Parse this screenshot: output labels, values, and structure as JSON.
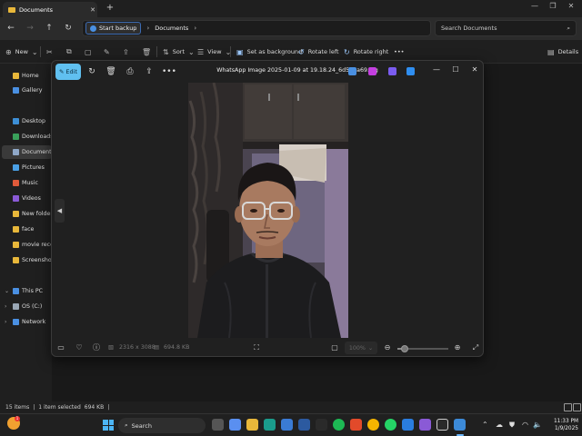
{
  "explorer": {
    "tab_title": "Documents",
    "tab_close": "✕",
    "new_tab": "+",
    "breadcrumb": [
      "Start backup",
      "Documents"
    ],
    "search_placeholder": "Search Documents",
    "commands": {
      "new": "New",
      "sort": "Sort",
      "view": "View",
      "set_background": "Set as background",
      "rotate_left": "Rotate left",
      "rotate_right": "Rotate right",
      "more": "•••",
      "details": "Details"
    },
    "sidebar": [
      {
        "label": "Home",
        "color": "#e8b73a"
      },
      {
        "label": "Gallery",
        "color": "#4a90e2"
      },
      {
        "label": "Desktop",
        "color": "#3d8fd6"
      },
      {
        "label": "Downloads",
        "color": "#39a05a"
      },
      {
        "label": "Documents",
        "color": "#8fa8c8"
      },
      {
        "label": "Pictures",
        "color": "#4aa0e6"
      },
      {
        "label": "Music",
        "color": "#e05a3a"
      },
      {
        "label": "Videos",
        "color": "#8a5ad6"
      },
      {
        "label": "New folder",
        "color": "#e8b73a"
      },
      {
        "label": "face",
        "color": "#e8b73a"
      },
      {
        "label": "movie recomme",
        "color": "#e8b73a"
      },
      {
        "label": "Screenshots",
        "color": "#e8b73a"
      },
      {
        "label": "This PC",
        "color": "#4a90e2"
      },
      {
        "label": "OS (C:)",
        "color": "#9aa7b5"
      },
      {
        "label": "Network",
        "color": "#4a90e2"
      }
    ],
    "status": {
      "items": "15 items",
      "selected": "1 item selected",
      "size": "694 KB"
    }
  },
  "viewer": {
    "edit_label": "Edit",
    "title": "WhatsApp Image 2025-01-09 at 19.18.24_6d549a69.jpg",
    "dimensions": "2316 x 3088",
    "file_size": "694.8 KB",
    "zoom": "100%",
    "zoom_level": 0.15
  },
  "taskbar": {
    "search_label": "Search",
    "time": "11:33 PM",
    "date": "1/9/2025",
    "weather_badge": "1"
  }
}
